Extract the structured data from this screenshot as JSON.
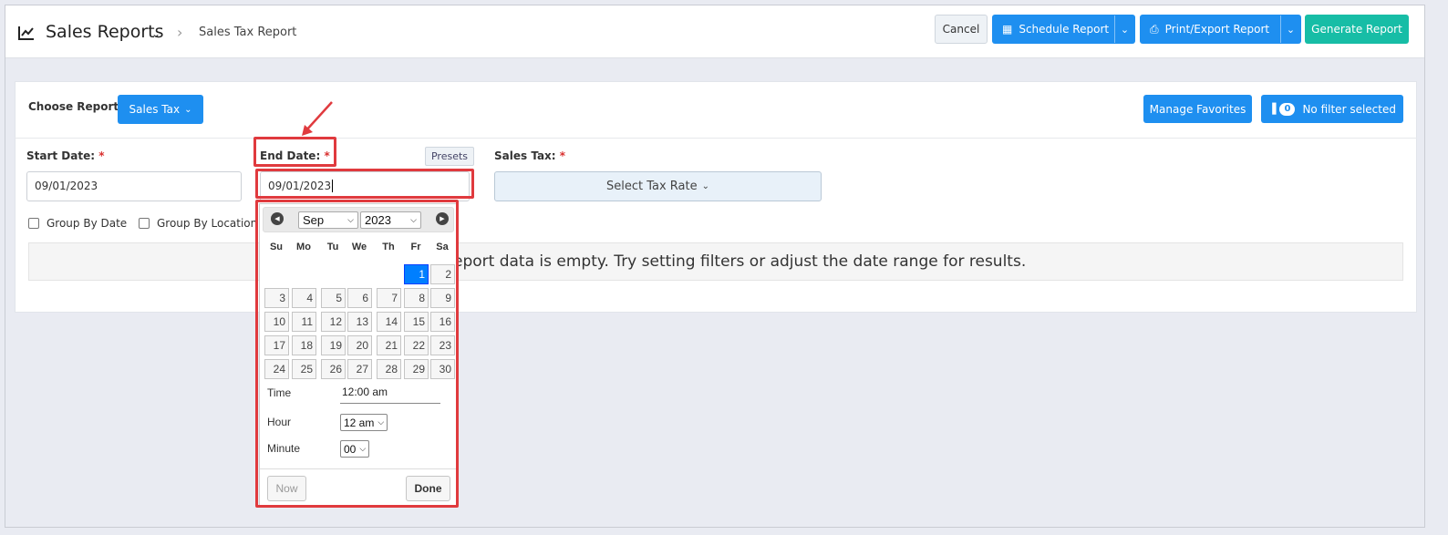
{
  "header": {
    "title": "Sales Reports",
    "breadcrumb": "Sales Tax Report",
    "icon": "line-chart-icon",
    "buttons": {
      "cancel": "Cancel",
      "schedule": "Schedule Report",
      "print": "Print/Export Report",
      "generate": "Generate Report"
    }
  },
  "report": {
    "choose_label": "Choose Report",
    "selected": "Sales Tax",
    "manage_favorites": "Manage Favorites",
    "filter_count": "0",
    "filter_text": "No filter selected"
  },
  "form": {
    "start_label": "Start Date:",
    "start_value": "09/01/2023",
    "end_label": "End Date:",
    "end_value": "09/01/2023",
    "presets": "Presets",
    "tax_label": "Sales Tax:",
    "tax_select": "Select Tax Rate",
    "required_mark": "*",
    "group_by_date": "Group By Date",
    "group_by_location": "Group By Location",
    "empty_message": "eport data is empty. Try setting filters or adjust the date range for results."
  },
  "datepicker": {
    "month": "Sep",
    "year": "2023",
    "weekdays": [
      "Su",
      "Mo",
      "Tu",
      "We",
      "Th",
      "Fr",
      "Sa"
    ],
    "weeks": [
      [
        "",
        "",
        "",
        "",
        "",
        "1",
        "2"
      ],
      [
        "3",
        "4",
        "5",
        "6",
        "7",
        "8",
        "9"
      ],
      [
        "10",
        "11",
        "12",
        "13",
        "14",
        "15",
        "16"
      ],
      [
        "17",
        "18",
        "19",
        "20",
        "21",
        "22",
        "23"
      ],
      [
        "24",
        "25",
        "26",
        "27",
        "28",
        "29",
        "30"
      ]
    ],
    "selected_day": "1",
    "time_label": "Time",
    "time_value": "12:00 am",
    "hour_label": "Hour",
    "hour_value": "12 am",
    "minute_label": "Minute",
    "minute_value": "00",
    "now": "Now",
    "done": "Done"
  },
  "colors": {
    "primary": "#1e8ff0",
    "generate": "#17bda6",
    "annotation": "#e03a3e",
    "selected_day": "#007fff"
  }
}
